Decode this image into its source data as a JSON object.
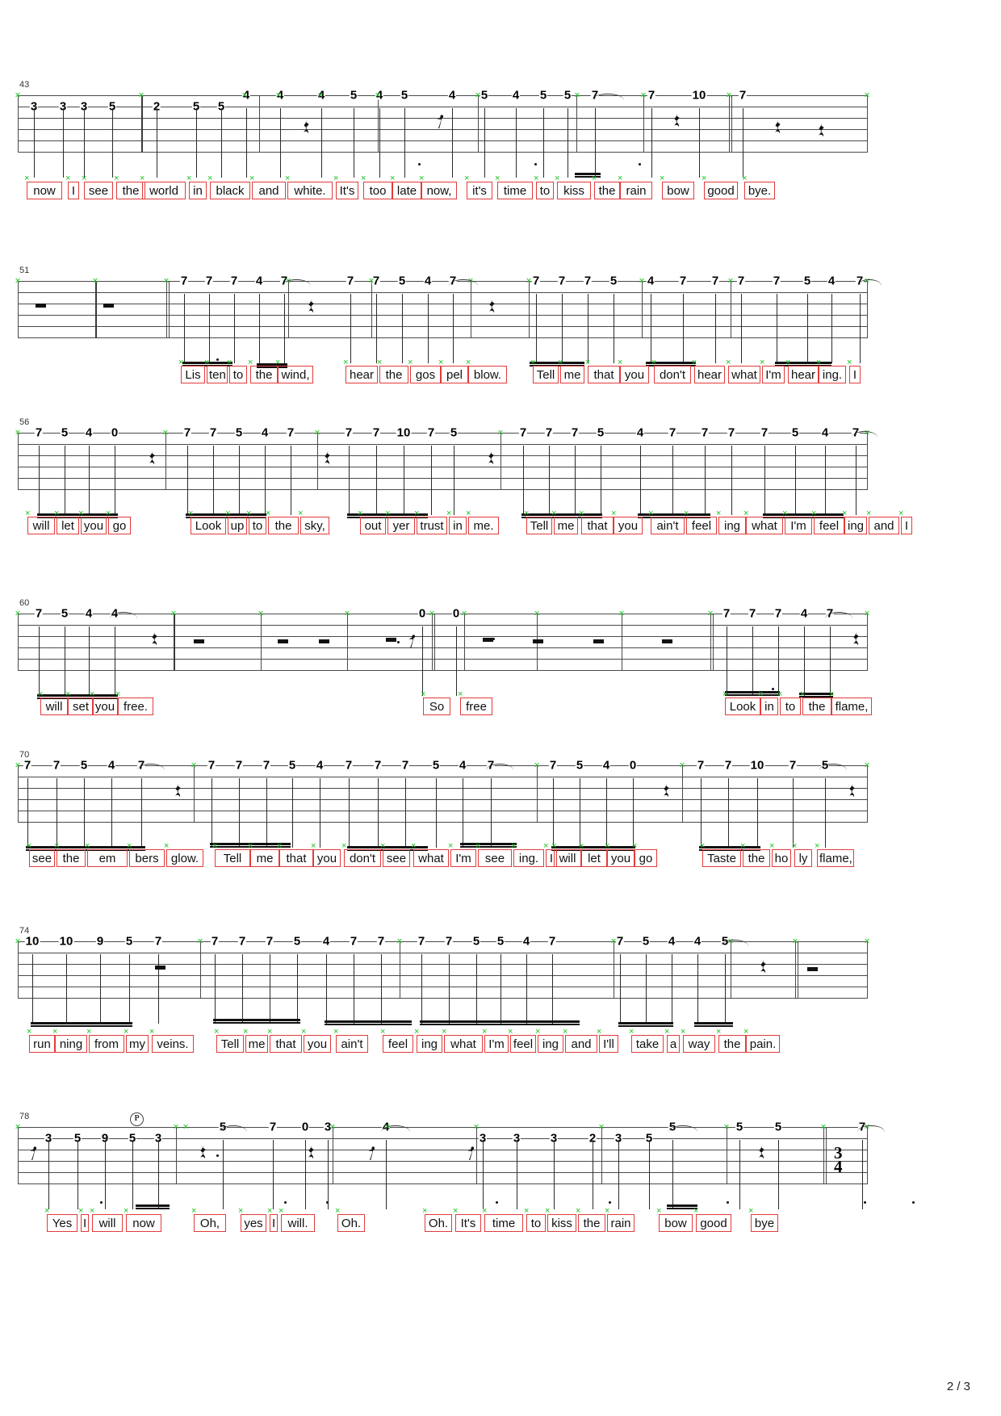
{
  "document": {
    "type": "guitar-tablature",
    "page_label": "2 / 3",
    "string_count": 6,
    "lyric_box_color": "#e23b3b",
    "beat_marker_color": "#18c21c",
    "staff_line_color": "#4a4a4a"
  },
  "systems": [
    {
      "measure_number": "43",
      "lyrics": [
        "now",
        "I",
        "see",
        "the",
        "world",
        "in",
        "black",
        "and",
        "white.",
        "It's",
        "too",
        "late",
        "now,",
        "it's",
        "time",
        "to",
        "kiss",
        "the",
        "rain",
        "bow",
        "good",
        "bye."
      ],
      "frets": [
        "3",
        "3",
        "3",
        "5",
        "2",
        "5",
        "5",
        "4",
        "4",
        "4",
        "5",
        "4",
        "5",
        "4",
        "5",
        "4",
        "5",
        "5",
        "7",
        "7",
        "10",
        "7"
      ],
      "symbols": [
        "half-rest",
        "eighth-rest",
        "quarter-rest",
        "half-rest",
        "whole-rest"
      ]
    },
    {
      "measure_number": "51",
      "lyrics": [
        "Lis",
        "ten",
        "to",
        "the",
        "wind,",
        "hear",
        "the",
        "gos",
        "pel",
        "blow.",
        "Tell",
        "me",
        "that",
        "you",
        "don't",
        "hear",
        "what",
        "I'm",
        "hear",
        "ing.",
        "I"
      ],
      "frets": [
        "7",
        "7",
        "7",
        "4",
        "7",
        "7",
        "7",
        "5",
        "4",
        "7",
        "7",
        "7",
        "7",
        "5",
        "4",
        "7",
        "7",
        "7",
        "7",
        "5",
        "4",
        "7"
      ],
      "symbols": [
        "whole-rest",
        "whole-rest",
        "quarter-rest",
        "quarter-rest"
      ]
    },
    {
      "measure_number": "56",
      "lyrics": [
        "will",
        "let",
        "you",
        "go",
        "Look",
        "up",
        "to",
        "the",
        "sky,",
        "out",
        "yer",
        "trust",
        "in",
        "me.",
        "Tell",
        "me",
        "that",
        "you",
        "ain't",
        "feel",
        "ing",
        "what",
        "I'm",
        "feel",
        "ing",
        "and",
        "I"
      ],
      "frets": [
        "7",
        "5",
        "4",
        "0",
        "7",
        "7",
        "5",
        "4",
        "7",
        "7",
        "7",
        "10",
        "7",
        "5",
        "7",
        "7",
        "7",
        "5",
        "4",
        "7",
        "7",
        "7",
        "7",
        "5",
        "4",
        "7"
      ],
      "symbols": [
        "quarter-rest",
        "quarter-rest",
        "quarter-rest"
      ]
    },
    {
      "measure_number": "60",
      "lyrics": [
        "will",
        "set",
        "you",
        "free.",
        "So",
        "free",
        "Look",
        "in",
        "to",
        "the",
        "flame,"
      ],
      "frets": [
        "7",
        "5",
        "4",
        "4",
        "0",
        "0",
        "7",
        "7",
        "7",
        "4",
        "7"
      ],
      "symbols": [
        "quarter-rest",
        "half-rest",
        "half-rest",
        "half-rest",
        "half-rest",
        "eighth-rest",
        "half-rest",
        "half-rest",
        "half-rest",
        "half-rest",
        "quarter-rest"
      ]
    },
    {
      "measure_number": "70",
      "lyrics": [
        "see",
        "the",
        "em",
        "bers",
        "glow.",
        "Tell",
        "me",
        "that",
        "you",
        "don't",
        "see",
        "what",
        "I'm",
        "see",
        "ing.",
        "I",
        "will",
        "let",
        "you",
        "go",
        "Taste",
        "the",
        "ho",
        "ly",
        "flame,"
      ],
      "frets": [
        "7",
        "7",
        "5",
        "4",
        "7",
        "7",
        "7",
        "7",
        "5",
        "4",
        "7",
        "7",
        "7",
        "5",
        "4",
        "7",
        "7",
        "5",
        "4",
        "0",
        "7",
        "7",
        "10",
        "7",
        "5"
      ],
      "symbols": [
        "quarter-rest",
        "quarter-rest",
        "quarter-rest"
      ]
    },
    {
      "measure_number": "74",
      "lyrics": [
        "run",
        "ning",
        "from",
        "my",
        "veins.",
        "Tell",
        "me",
        "that",
        "you",
        "ain't",
        "feel",
        "ing",
        "what",
        "I'm",
        "feel",
        "ing",
        "and",
        "I'll",
        "take",
        "a",
        "way",
        "the",
        "pain."
      ],
      "frets": [
        "10",
        "10",
        "9",
        "5",
        "7",
        "7",
        "7",
        "7",
        "5",
        "4",
        "7",
        "7",
        "7",
        "7",
        "5",
        "5",
        "4",
        "7",
        "7",
        "5",
        "4",
        "4",
        "5"
      ],
      "symbols": [
        "half-rest",
        "quarter-rest",
        "half-rest"
      ]
    },
    {
      "measure_number": "78",
      "lyrics": [
        "Yes",
        "I",
        "will",
        "now",
        "Oh,",
        "yes",
        "I",
        "will.",
        "Oh.",
        "Oh.",
        "It's",
        "time",
        "to",
        "kiss",
        "the",
        "rain",
        "bow",
        "good",
        "bye"
      ],
      "frets": [
        "3",
        "5",
        "9",
        "5",
        "3",
        "5",
        "7",
        "0",
        "3",
        "4",
        "3",
        "3",
        "3",
        "2",
        "3",
        "5",
        "5",
        "5",
        "5",
        "7"
      ],
      "symbols": [
        "eighth-rest",
        "dotted-quarter-rest",
        "eighth-rest",
        "quarter-rest",
        "eighth-rest",
        "quarter-rest",
        "time-signature-3-4",
        "P-circled"
      ],
      "time_signature": {
        "top": "3",
        "bottom": "4"
      },
      "articulation": "P"
    }
  ]
}
